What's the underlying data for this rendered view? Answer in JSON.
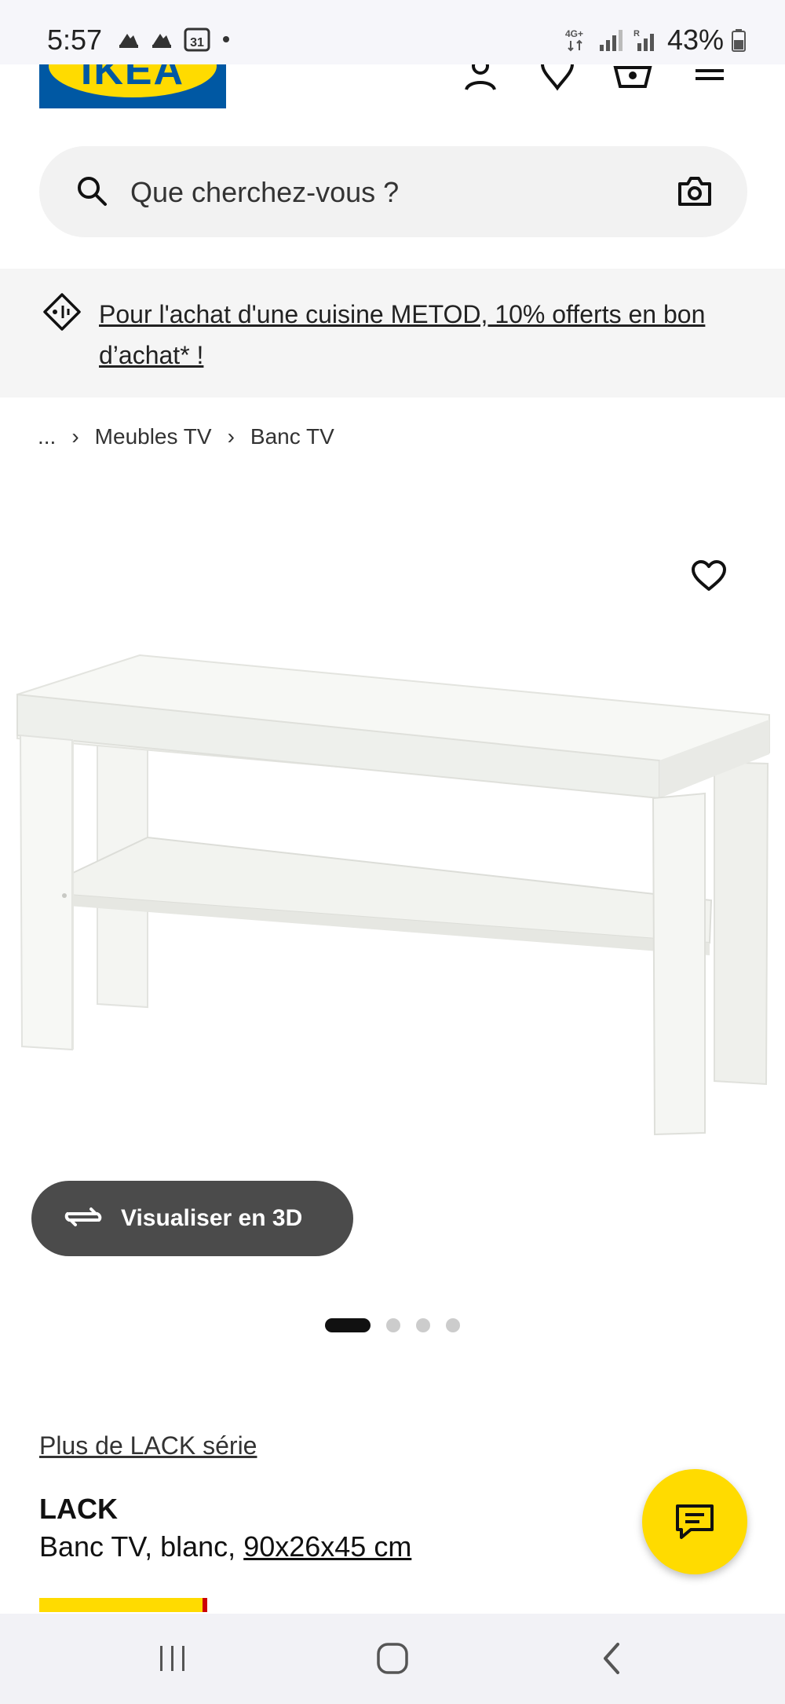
{
  "status_bar": {
    "time": "5:57",
    "network": "4G+",
    "battery": "43%",
    "calendar_day": "31",
    "icons": [
      "news-icon",
      "news-icon",
      "calendar-icon",
      "dot-icon",
      "signal-icon",
      "battery-icon"
    ]
  },
  "header": {
    "logo": "IKEA",
    "icons": [
      "account-icon",
      "heart-icon",
      "cart-icon",
      "menu-icon"
    ],
    "brand_colors": {
      "blue": "#0058a3",
      "yellow": "#ffdb00"
    }
  },
  "search": {
    "placeholder": "Que cherchez-vous ?"
  },
  "promo": {
    "text": "Pour l'achat d'une cuisine METOD, 10% offerts en bon d’achat* !"
  },
  "breadcrumb": {
    "items": [
      "...",
      "Meubles TV",
      "Banc TV"
    ]
  },
  "gallery": {
    "view3d_label": "Visualiser en 3D",
    "slide_count": 4,
    "active_slide": 1
  },
  "product": {
    "series_link": "Plus de LACK série",
    "name": "LACK",
    "desc_prefix": "Banc TV, blanc, ",
    "dimensions": "90x26x45 cm"
  },
  "nav_bar": {
    "buttons": [
      "recents-icon",
      "home-icon",
      "back-icon"
    ]
  }
}
